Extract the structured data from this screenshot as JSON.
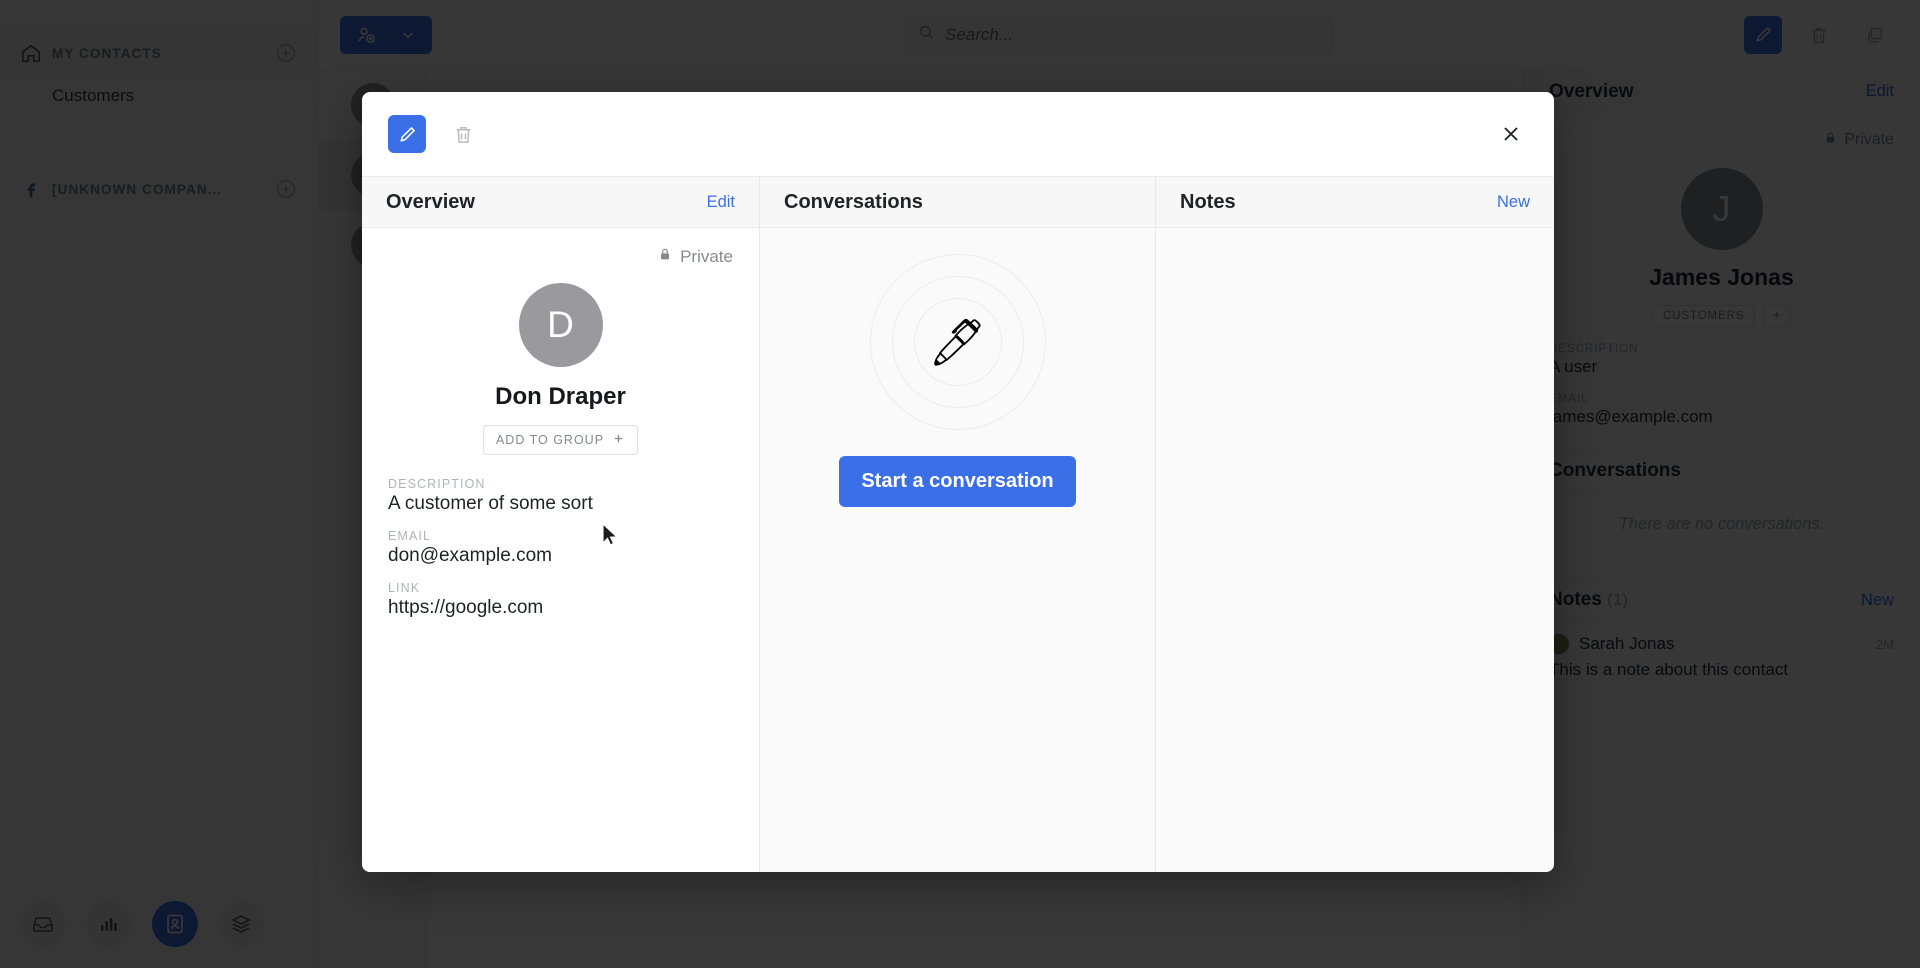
{
  "sidebar": {
    "sections": [
      {
        "icon": "home-icon",
        "title": "MY CONTACTS",
        "add_icon": "plus-circle-icon",
        "items": [
          {
            "label": "Customers"
          }
        ]
      },
      {
        "icon": "facebook-icon",
        "title": "[UNKNOWN COMPAN...",
        "add_icon": "plus-circle-icon",
        "items": []
      }
    ],
    "bottom_nav": [
      {
        "name": "inbox-icon",
        "active": false
      },
      {
        "name": "stats-icon",
        "active": false
      },
      {
        "name": "contacts-icon",
        "active": true
      },
      {
        "name": "layers-icon",
        "active": false
      }
    ]
  },
  "topbar": {
    "add_contact_icon": "add-person-icon",
    "add_contact_chevron": "chevron-down-icon",
    "search": {
      "placeholder": "Search...",
      "value": "",
      "icon": "search-icon"
    },
    "edit_icon": "pencil-icon",
    "delete_icon": "trash-icon",
    "duplicate_icon": "copy-icon"
  },
  "contact_list": [
    {
      "initial": "",
      "selected": false
    },
    {
      "initial": "",
      "selected": true
    },
    {
      "initial": "",
      "selected": false
    }
  ],
  "right_panel": {
    "header": {
      "title": "Overview",
      "action": "Edit"
    },
    "privacy": {
      "label": "Private",
      "icon": "lock-icon"
    },
    "avatar_initial": "J",
    "name": "James Jonas",
    "tags": [
      "CUSTOMERS"
    ],
    "add_tag_label": "+",
    "fields": [
      {
        "label": "DESCRIPTION",
        "value": "A user"
      },
      {
        "label": "EMAIL",
        "value": "james@example.com"
      }
    ],
    "conversations": {
      "title": "Conversations",
      "empty_text": "There are no conversations."
    },
    "notes": {
      "title": "Notes",
      "count": "(1)",
      "action": "New",
      "items": [
        {
          "author": "Sarah Jonas",
          "time": "2M",
          "text": "This is a note about this contact"
        }
      ]
    }
  },
  "modal": {
    "toolbar": {
      "edit_icon": "pencil-icon",
      "delete_icon": "trash-icon",
      "close_icon": "close-icon"
    },
    "overview": {
      "header": {
        "title": "Overview",
        "action": "Edit"
      },
      "privacy": {
        "label": "Private",
        "icon": "lock-icon"
      },
      "avatar_initial": "D",
      "name": "Don Draper",
      "add_to_group": {
        "label": "ADD TO GROUP",
        "icon": "plus-icon"
      },
      "fields": [
        {
          "label": "DESCRIPTION",
          "value": "A customer of some sort"
        },
        {
          "label": "EMAIL",
          "value": "don@example.com"
        },
        {
          "label": "LINK",
          "value": "https://google.com"
        }
      ]
    },
    "conversations": {
      "header": {
        "title": "Conversations"
      },
      "empty_illustration_icon": "pen-icon",
      "start_button": "Start a conversation"
    },
    "notes": {
      "header": {
        "title": "Notes",
        "action": "New"
      },
      "items": []
    }
  },
  "colors": {
    "accent_blue": "#3b6fe8",
    "avatar_gray": "#9a9a9e",
    "panel_bg": "#fafafb",
    "modal_bg": "#ffffff"
  }
}
